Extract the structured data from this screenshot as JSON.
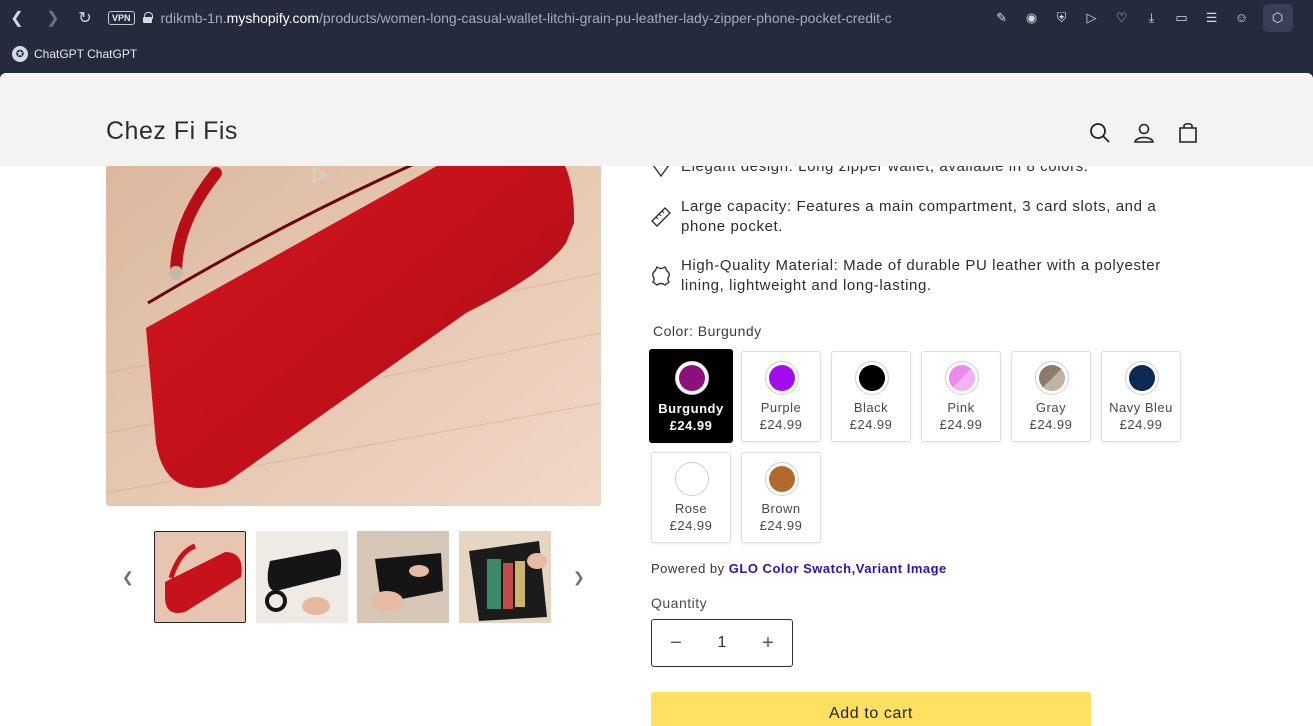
{
  "browser": {
    "url_prefix": "rdikmb-1n.",
    "url_host": "myshopify.com",
    "url_path": "/products/women-long-casual-wallet-litchi-grain-pu-leather-lady-zipper-phone-pocket-credit-c",
    "vpn_label": "VPN",
    "bookmark_label": "ChatGPT ChatGPT"
  },
  "store": {
    "name": "Chez Fi Fis"
  },
  "features": [
    "Elegant design: Long zipper wallet, available in 8 colors.",
    "Large capacity: Features a main compartment, 3 card slots, and a phone pocket.",
    "High-Quality Material: Made of durable PU leather with a polyester lining, lightweight and long-lasting."
  ],
  "color": {
    "label": "Color: Burgundy",
    "swatches": [
      {
        "name": "Burgundy",
        "price": "£24.99",
        "color": "#8e0f7a",
        "selected": true
      },
      {
        "name": "Purple",
        "price": "£24.99",
        "color": "#a40cf0"
      },
      {
        "name": "Black",
        "price": "£24.99",
        "color": "#000000"
      },
      {
        "name": "Pink",
        "price": "£24.99",
        "color": "#e98cf0"
      },
      {
        "name": "Gray",
        "price": "£24.99",
        "color": "#9b8c7e"
      },
      {
        "name": "Navy Bleu",
        "price": "£24.99",
        "color": "#0c2a52"
      },
      {
        "name": "Rose",
        "price": "£24.99",
        "color": "#ffffff"
      },
      {
        "name": "Brown",
        "price": "£24.99",
        "color": "#b26a2c"
      }
    ]
  },
  "powered": {
    "prefix": "Powered by",
    "link": "GLO Color Swatch,Variant Image"
  },
  "quantity": {
    "label": "Quantity",
    "value": "1",
    "minus": "−",
    "plus": "+"
  },
  "cart": {
    "label": "Add to cart"
  }
}
